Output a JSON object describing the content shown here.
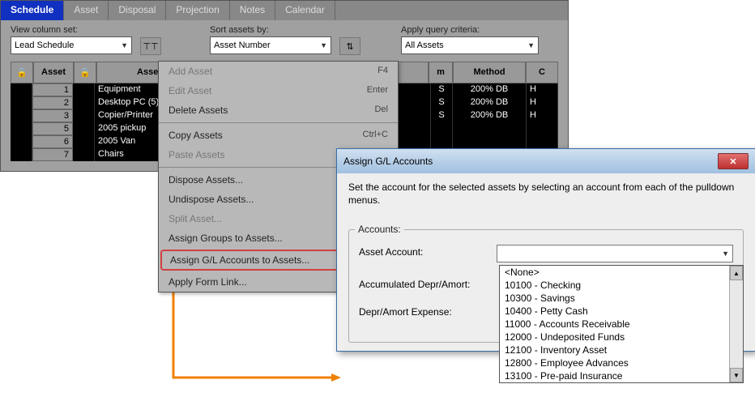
{
  "tabs": [
    "Schedule",
    "Asset",
    "Disposal",
    "Projection",
    "Notes",
    "Calendar"
  ],
  "active_tab": "Schedule",
  "controls": {
    "view_label": "View column set:",
    "view_value": "Lead Schedule",
    "sort_label": "Sort assets by:",
    "sort_value": "Asset  Number",
    "query_label": "Apply query criteria:",
    "query_value": "All Assets"
  },
  "table": {
    "headers": {
      "num": "Asset",
      "asset": "Asset",
      "m": "m",
      "method": "Method",
      "c": "C"
    },
    "rows": [
      {
        "num": "1",
        "name": "Equipment",
        "s": "S",
        "method": "200% DB",
        "h": "H"
      },
      {
        "num": "2",
        "name": "Desktop PC (5)",
        "s": "S",
        "method": "200% DB",
        "h": "H"
      },
      {
        "num": "3",
        "name": "Copier/Printer",
        "s": "S",
        "method": "200% DB",
        "h": "H"
      },
      {
        "num": "5",
        "name": "2005 pickup",
        "s": "",
        "method": "",
        "h": ""
      },
      {
        "num": "6",
        "name": "2005 Van",
        "s": "",
        "method": "",
        "h": ""
      },
      {
        "num": "7",
        "name": "Chairs",
        "s": "",
        "method": "",
        "h": ""
      }
    ]
  },
  "menu": [
    {
      "label": "Add Asset",
      "shortcut": "F4",
      "disabled": true
    },
    {
      "label": "Edit Asset",
      "shortcut": "Enter",
      "disabled": true
    },
    {
      "label": "Delete Assets",
      "shortcut": "Del",
      "disabled": false
    },
    {
      "sep": true
    },
    {
      "label": "Copy Assets",
      "shortcut": "Ctrl+C",
      "disabled": false
    },
    {
      "label": "Paste Assets",
      "shortcut": "",
      "disabled": true
    },
    {
      "sep": true
    },
    {
      "label": "Dispose Assets...",
      "shortcut": "",
      "disabled": false
    },
    {
      "label": "Undispose Assets...",
      "shortcut": "",
      "disabled": false
    },
    {
      "label": "Split Asset...",
      "shortcut": "",
      "disabled": true
    },
    {
      "label": "Assign Groups to Assets...",
      "shortcut": "",
      "disabled": false
    },
    {
      "label": "Assign G/L Accounts to Assets...",
      "shortcut": "",
      "disabled": false,
      "highlighted": true
    },
    {
      "label": "Apply Form Link...",
      "shortcut": "",
      "disabled": false
    }
  ],
  "dialog": {
    "title": "Assign G/L Accounts",
    "text": "Set the account for the selected assets by selecting an account from each of the pulldown menus.",
    "group_label": "Accounts:",
    "fields": {
      "asset_account": "Asset Account:",
      "accum": "Accumulated Depr/Amort:",
      "expense": "Depr/Amort Expense:"
    },
    "options": [
      "<None>",
      "10100 - Checking",
      "10300 - Savings",
      "10400 - Petty Cash",
      "11000 - Accounts Receivable",
      "12000 - Undeposited Funds",
      "12100 - Inventory Asset",
      "12800 - Employee Advances",
      "13100 - Pre-paid Insurance"
    ]
  }
}
